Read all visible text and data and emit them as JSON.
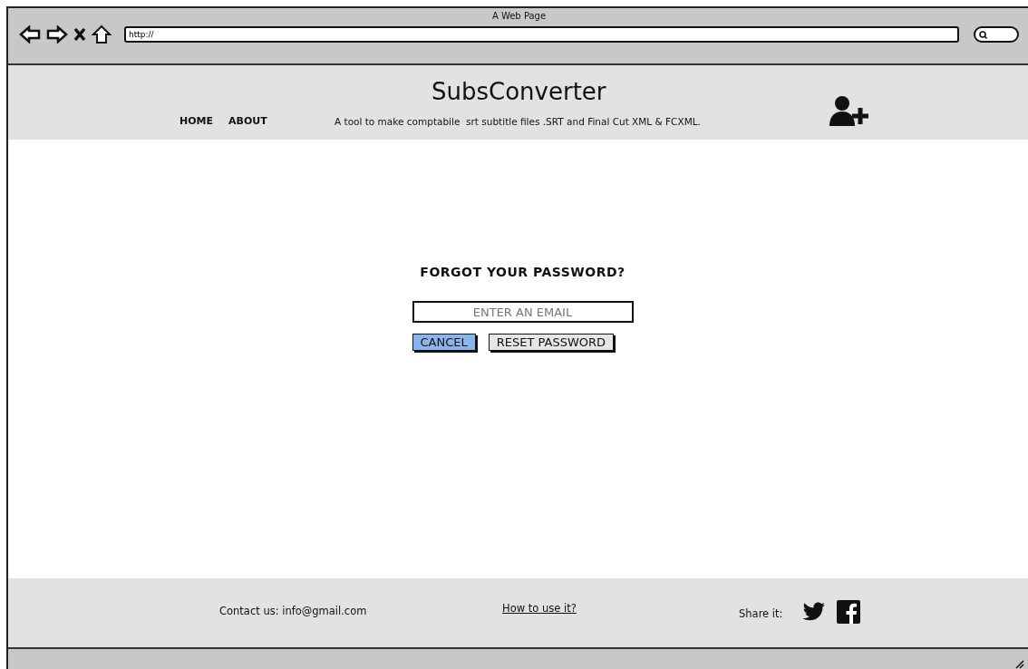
{
  "window": {
    "title": "A Web Page"
  },
  "address_bar": {
    "value": "http://"
  },
  "header": {
    "title": "SubsConverter",
    "tagline": "A tool to make comptabile  srt subtitle files .SRT and Final Cut XML & FCXML.",
    "nav": [
      {
        "label": "HOME"
      },
      {
        "label": "ABOUT"
      }
    ]
  },
  "form": {
    "heading": "FORGOT YOUR PASSWORD?",
    "email": {
      "placeholder": "ENTER AN EMAIL"
    },
    "buttons": [
      {
        "label": "CANCEL",
        "kind": "primary"
      },
      {
        "label": "RESET PASSWORD",
        "kind": "secondary"
      }
    ]
  },
  "footer": {
    "contact": "Contact us: info@gmail.com",
    "help_link": "How to use it?",
    "share_label": "Share it:"
  }
}
